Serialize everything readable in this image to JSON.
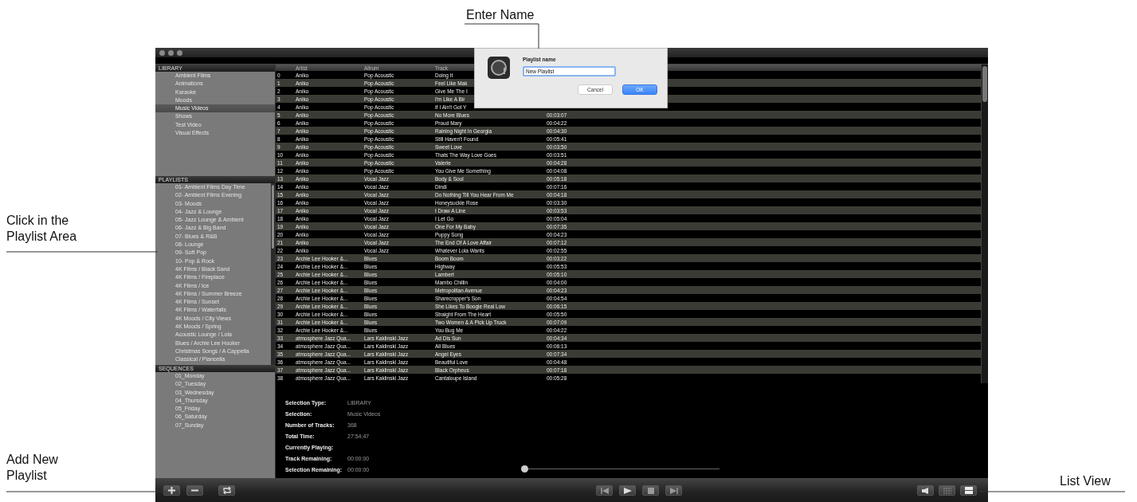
{
  "callouts": {
    "enter_name": "Enter Name",
    "playlist_area": "Click in the Playlist Area",
    "add_playlist": "Add New Playlist",
    "list_view": "List View"
  },
  "sidebar": [
    {
      "title": "LIBRARY",
      "scroll": false,
      "items": [
        {
          "label": "Ambient Films",
          "selected": false
        },
        {
          "label": "Animations",
          "selected": false
        },
        {
          "label": "Karaoke",
          "selected": false
        },
        {
          "label": "Moods",
          "selected": false
        },
        {
          "label": "Music Videos",
          "selected": true
        },
        {
          "label": "Shows",
          "selected": false
        },
        {
          "label": "Test Video",
          "selected": false
        },
        {
          "label": "Visual Effects",
          "selected": false
        }
      ]
    },
    {
      "title": "PLAYLISTS",
      "scroll": true,
      "items": [
        {
          "label": "01- Ambient Films Day Time",
          "selected": false
        },
        {
          "label": "02- Ambient Films Evening",
          "selected": false
        },
        {
          "label": "03- Moods",
          "selected": false
        },
        {
          "label": "04- Jazz & Lounge",
          "selected": false
        },
        {
          "label": "05- Jazz Lounge & Ambient",
          "selected": false
        },
        {
          "label": "06- Jazz & Big Band",
          "selected": false
        },
        {
          "label": "07- Blues & R&B",
          "selected": false
        },
        {
          "label": "08- Lounge",
          "selected": false
        },
        {
          "label": "09- Soft Pop",
          "selected": false
        },
        {
          "label": "10- Pop & Rock",
          "selected": false
        },
        {
          "label": "4K Films / Black Sand",
          "selected": false
        },
        {
          "label": "4K Films / Fireplace",
          "selected": false
        },
        {
          "label": "4K Films / Ice",
          "selected": false
        },
        {
          "label": "4K Films / Summer Breeze",
          "selected": false
        },
        {
          "label": "4K Films / Sunset",
          "selected": false
        },
        {
          "label": "4K Films / Waterfalls",
          "selected": false
        },
        {
          "label": "4K Moods / City Views",
          "selected": false
        },
        {
          "label": "4K Moods / Spring",
          "selected": false
        },
        {
          "label": "Acoustic Lounge / Lola",
          "selected": false
        },
        {
          "label": "Blues / Archie Lee Hooker",
          "selected": false
        },
        {
          "label": "Christmas Songs / A Cappella",
          "selected": false
        },
        {
          "label": "Classical / Piancella",
          "selected": false
        }
      ]
    },
    {
      "title": "SEQUENCES",
      "scroll": false,
      "items": [
        {
          "label": "01_Monday",
          "selected": false
        },
        {
          "label": "02_Tuesday",
          "selected": false
        },
        {
          "label": "03_Wednesday",
          "selected": false
        },
        {
          "label": "04_Thursday",
          "selected": false
        },
        {
          "label": "05_Friday",
          "selected": false
        },
        {
          "label": "06_Saturday",
          "selected": false
        },
        {
          "label": "07_Sunday",
          "selected": false
        }
      ]
    }
  ],
  "table": {
    "columns": [
      "Artist",
      "Album",
      "Track"
    ],
    "rows": [
      {
        "n": "0",
        "artist": "Aniko",
        "album": "Pop Acoustic",
        "track": "Doing It"
      },
      {
        "n": "1",
        "artist": "Aniko",
        "album": "Pop Acoustic",
        "track": "Feel Like Mak"
      },
      {
        "n": "2",
        "artist": "Aniko",
        "album": "Pop Acoustic",
        "track": "Give Me The I"
      },
      {
        "n": "3",
        "artist": "Aniko",
        "album": "Pop Acoustic",
        "track": "I'm Like A Bir"
      },
      {
        "n": "4",
        "artist": "Aniko",
        "album": "Pop Acoustic",
        "track": "If I Ain't Got Y"
      },
      {
        "n": "5",
        "artist": "Aniko",
        "album": "Pop Acoustic",
        "track": "No More Blues",
        "time": "00:03:07"
      },
      {
        "n": "6",
        "artist": "Aniko",
        "album": "Pop Acoustic",
        "track": "Proud Mary",
        "time": "00:04:22"
      },
      {
        "n": "7",
        "artist": "Aniko",
        "album": "Pop Acoustic",
        "track": "Raining Night In Georgia",
        "time": "00:04:30"
      },
      {
        "n": "8",
        "artist": "Aniko",
        "album": "Pop Acoustic",
        "track": "Still Haven't Found",
        "time": "00:05:41"
      },
      {
        "n": "9",
        "artist": "Aniko",
        "album": "Pop Acoustic",
        "track": "Sweet Love",
        "time": "00:03:50"
      },
      {
        "n": "10",
        "artist": "Aniko",
        "album": "Pop Acoustic",
        "track": "Thats The Way Love Goes",
        "time": "00:03:51"
      },
      {
        "n": "11",
        "artist": "Aniko",
        "album": "Pop Acoustic",
        "track": "Valerie",
        "time": "00:04:28"
      },
      {
        "n": "12",
        "artist": "Aniko",
        "album": "Pop Acoustic",
        "track": "You Give Me Something",
        "time": "00:04:08"
      },
      {
        "n": "13",
        "artist": "Aniko",
        "album": "Vocal Jazz",
        "track": "Body & Soul",
        "time": "00:05:18"
      },
      {
        "n": "14",
        "artist": "Aniko",
        "album": "Vocal Jazz",
        "track": "Dindi",
        "time": "00:07:16"
      },
      {
        "n": "15",
        "artist": "Aniko",
        "album": "Vocal Jazz",
        "track": "Do Nothing Till You Hear From Me",
        "time": "00:04:18"
      },
      {
        "n": "16",
        "artist": "Aniko",
        "album": "Vocal Jazz",
        "track": "Honeysuckle Rose",
        "time": "00:03:30"
      },
      {
        "n": "17",
        "artist": "Aniko",
        "album": "Vocal Jazz",
        "track": "I Draw A Line",
        "time": "00:03:53"
      },
      {
        "n": "18",
        "artist": "Aniko",
        "album": "Vocal Jazz",
        "track": "I Let Go",
        "time": "00:05:04"
      },
      {
        "n": "19",
        "artist": "Aniko",
        "album": "Vocal Jazz",
        "track": "One For My Baby",
        "time": "00:07:35"
      },
      {
        "n": "20",
        "artist": "Aniko",
        "album": "Vocal Jazz",
        "track": "Puppy Song",
        "time": "00:04:23"
      },
      {
        "n": "21",
        "artist": "Aniko",
        "album": "Vocal Jazz",
        "track": "The End Of A Love Affair",
        "time": "00:07:12"
      },
      {
        "n": "22",
        "artist": "Aniko",
        "album": "Vocal Jazz",
        "track": "Whatever Lola Wants",
        "time": "00:02:55"
      },
      {
        "n": "23",
        "artist": "Archie Lee Hooker &...",
        "album": "Blues",
        "track": "Boom Boom",
        "time": "00:03:22"
      },
      {
        "n": "24",
        "artist": "Archie Lee Hooker &...",
        "album": "Blues",
        "track": "Highway",
        "time": "00:05:53"
      },
      {
        "n": "25",
        "artist": "Archie Lee Hooker &...",
        "album": "Blues",
        "track": "Lambert",
        "time": "00:05:10"
      },
      {
        "n": "26",
        "artist": "Archie Lee Hooker &...",
        "album": "Blues",
        "track": "Mambo Chillin",
        "time": "00:04:00"
      },
      {
        "n": "27",
        "artist": "Archie Lee Hooker &...",
        "album": "Blues",
        "track": "Metropolitan Avenue",
        "time": "00:04:23"
      },
      {
        "n": "28",
        "artist": "Archie Lee Hooker &...",
        "album": "Blues",
        "track": "Sharecropper's Son",
        "time": "00:04:54"
      },
      {
        "n": "29",
        "artist": "Archie Lee Hooker &...",
        "album": "Blues",
        "track": "She Likes To Boogie Real Low",
        "time": "00:06:15"
      },
      {
        "n": "30",
        "artist": "Archie Lee Hooker &...",
        "album": "Blues",
        "track": "Straight From The Heart",
        "time": "00:05:50"
      },
      {
        "n": "31",
        "artist": "Archie Lee Hooker &...",
        "album": "Blues",
        "track": "Two Women & A Pick Up Truck",
        "time": "00:07:09"
      },
      {
        "n": "32",
        "artist": "Archie Lee Hooker &...",
        "album": "Blues",
        "track": "You Bug Me",
        "time": "00:04:22"
      },
      {
        "n": "33",
        "artist": "atmosphere Jazz Qua...",
        "album": "Lars Kaklinski Jazz",
        "track": "Ad Dis Sun",
        "time": "00:04:34"
      },
      {
        "n": "34",
        "artist": "atmosphere Jazz Qua...",
        "album": "Lars Kaklinski Jazz",
        "track": "All Blues",
        "time": "00:06:13"
      },
      {
        "n": "35",
        "artist": "atmosphere Jazz Qua...",
        "album": "Lars Kaklinski Jazz",
        "track": "Angel Eyes",
        "time": "00:07:34"
      },
      {
        "n": "36",
        "artist": "atmosphere Jazz Qua...",
        "album": "Lars Kaklinski Jazz",
        "track": "Beautiful Love",
        "time": "00:04:48"
      },
      {
        "n": "37",
        "artist": "atmosphere Jazz Qua...",
        "album": "Lars Kaklinski Jazz",
        "track": "Black Orpheus",
        "time": "00:07:18"
      },
      {
        "n": "38",
        "artist": "atmosphere Jazz Qua...",
        "album": "Lars Kaklinski Jazz",
        "track": "Cantaloupe Island",
        "time": "00:05:28"
      }
    ]
  },
  "info": [
    {
      "label": "Selection Type:",
      "value": "LIBRARY"
    },
    {
      "label": "Selection:",
      "value": "Music Videos"
    },
    {
      "label": "Number of Tracks:",
      "value": "368"
    },
    {
      "label": "Total Time:",
      "value": "27:54:47"
    },
    {
      "label": "Currently Playing:"
    },
    {
      "label": "Track Remaining:",
      "value": "00:00:00"
    },
    {
      "label": "Selection Remaining:",
      "value": "00:00:00"
    }
  ],
  "progress": {
    "level": 0
  },
  "dialog": {
    "title": "Playlist name",
    "value": "New Playlist",
    "buttons": [
      {
        "label": "Cancel",
        "kind": "secondary"
      },
      {
        "label": "OK",
        "kind": "primary"
      }
    ]
  }
}
